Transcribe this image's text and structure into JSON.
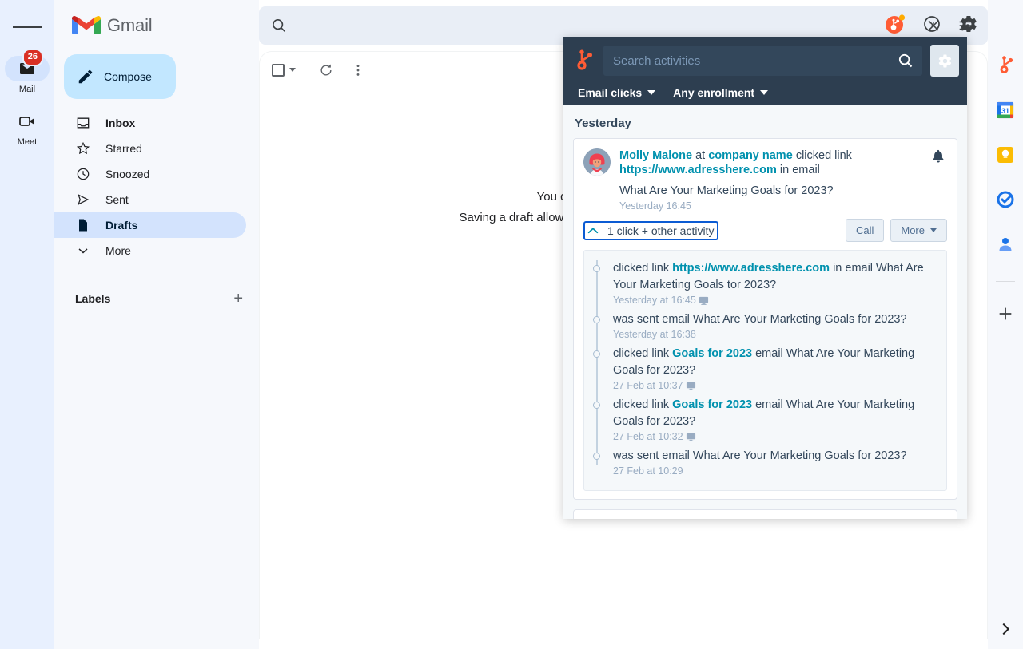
{
  "gmail": {
    "brand": "Gmail",
    "rail": {
      "menu_icon": "hamburger-menu-icon",
      "apps": [
        {
          "label": "Mail",
          "icon": "mail-icon",
          "badge": "26",
          "active": true
        },
        {
          "label": "Meet",
          "icon": "video-camera-icon",
          "badge": "",
          "active": false
        }
      ]
    },
    "compose": {
      "label": "Compose",
      "icon": "pencil-icon"
    },
    "nav": [
      {
        "label": "Inbox",
        "icon": "inbox-icon",
        "selected": false,
        "bold": true
      },
      {
        "label": "Starred",
        "icon": "star-icon",
        "selected": false,
        "bold": false
      },
      {
        "label": "Snoozed",
        "icon": "clock-icon",
        "selected": false,
        "bold": false
      },
      {
        "label": "Sent",
        "icon": "send-icon",
        "selected": false,
        "bold": false
      },
      {
        "label": "Drafts",
        "icon": "draft-document-icon",
        "selected": true,
        "bold": true
      },
      {
        "label": "More",
        "icon": "chevron-down-icon",
        "selected": false,
        "bold": false
      }
    ],
    "labels": {
      "title": "Labels",
      "add_icon": "plus-icon",
      "add_label": "+"
    },
    "search": {
      "value": "",
      "placeholder": "",
      "search_icon": "search-icon",
      "clear_icon": "close-icon",
      "options_icon": "search-options-icon"
    },
    "toolbar": {
      "select_icon": "checkbox-icon",
      "refresh_icon": "refresh-icon",
      "more_icon": "more-vertical-icon"
    },
    "empty_state": {
      "line1": "You don't have any saved drafts.",
      "line2": "Saving a draft allows you to write a message and send it later."
    },
    "top_icons": [
      {
        "name": "hubspot-notification-icon"
      },
      {
        "name": "help-icon"
      },
      {
        "name": "settings-gear-icon"
      }
    ],
    "right_rail": [
      {
        "name": "hubspot-sprocket-icon"
      },
      {
        "name": "google-calendar-icon"
      },
      {
        "name": "google-keep-icon"
      },
      {
        "name": "google-tasks-icon"
      },
      {
        "name": "google-contacts-icon"
      }
    ],
    "right_rail_add": "+",
    "expand_arrow": "chevron-right-icon"
  },
  "hubspot": {
    "logo": "hubspot-sprocket-logo",
    "search": {
      "value": "",
      "placeholder": "Search activities",
      "search_icon": "search-icon"
    },
    "settings_button": {
      "icon": "gear-icon"
    },
    "filters": [
      {
        "label": "Email clicks"
      },
      {
        "label": "Any enrollment"
      }
    ],
    "day_label": "Yesterday",
    "activity": {
      "avatar": "contact-avatar",
      "bell_icon": "bell-icon",
      "contact_name": "Molly Malone",
      "at_word": "at",
      "company_name": "company name",
      "action_text": "clicked link",
      "link_url": "https://www.adresshere.com",
      "in_email_text": "in email",
      "subject": "What Are Your Marketing Goals for 2023?",
      "timestamp": "Yesterday 16:45",
      "toggle_label": "1 click + other activity",
      "toggle_icon": "chevron-up-icon",
      "buttons": [
        {
          "label": "Call",
          "has_caret": false
        },
        {
          "label": "More",
          "has_caret": true
        }
      ]
    },
    "timeline": [
      {
        "prefix": "clicked link",
        "link": "https://www.adresshere.com",
        "link_style": "url",
        "suffix": "in email What Are Your Marketing Goals tor 2023?",
        "meta": "Yesterday at 16:45",
        "device_icon": "desktop-icon"
      },
      {
        "prefix": "was sent email What Are Your Marketing Goals for 2023?",
        "link": "",
        "link_style": "",
        "suffix": "",
        "meta": "Yesterday at 16:38",
        "device_icon": ""
      },
      {
        "prefix": "clicked link",
        "link": "Goals for 2023",
        "link_style": "bold",
        "suffix": "email What Are Your Marketing Goals for 2023?",
        "meta": "27 Feb at 10:37",
        "device_icon": "desktop-icon"
      },
      {
        "prefix": "clicked link",
        "link": "Goals for 2023",
        "link_style": "bold",
        "suffix": "email What Are Your Marketing Goals for 2023?",
        "meta": "27 Feb at 10:32",
        "device_icon": "desktop-icon"
      },
      {
        "prefix": "was sent email What Are Your Marketing Goals for 2023?",
        "link": "",
        "link_style": "",
        "suffix": "",
        "meta": "27 Feb at 10:29",
        "device_icon": ""
      }
    ]
  },
  "colors": {
    "hubspot_orange": "#ff5c35",
    "hubspot_navy": "#2d3e50",
    "hubspot_navy_light": "#33475b",
    "hubspot_teal": "#0091ae",
    "gmail_blue": "#c2e7ff",
    "badge_red": "#d93025",
    "focus_blue": "#0b5bd3"
  }
}
